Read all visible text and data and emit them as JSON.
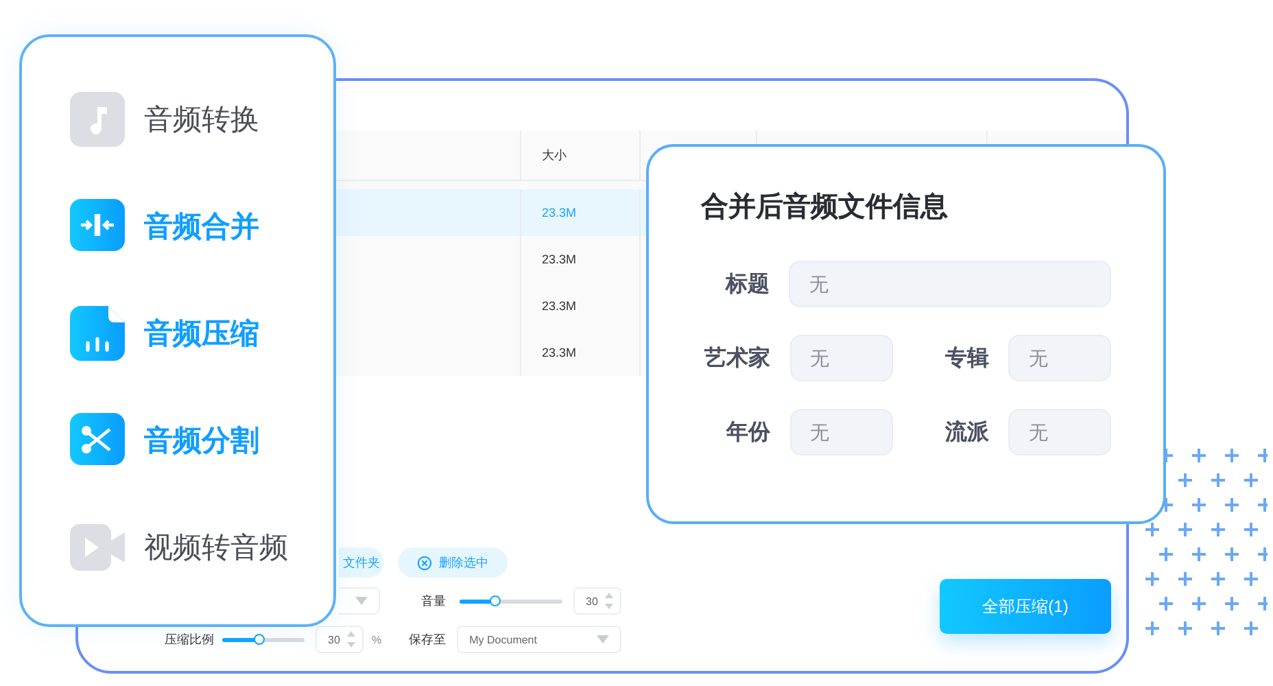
{
  "sidebar": {
    "items": [
      {
        "label": "音频转换",
        "active": false,
        "kind": "note"
      },
      {
        "label": "音频合并",
        "active": true,
        "kind": "merge"
      },
      {
        "label": "音频压缩",
        "active": true,
        "kind": "file"
      },
      {
        "label": "音频分割",
        "active": true,
        "kind": "scissors"
      },
      {
        "label": "视频转音频",
        "active": false,
        "kind": "video"
      }
    ]
  },
  "table": {
    "columns": [
      {
        "label": "大小"
      }
    ],
    "rows": [
      {
        "size": "23.3M",
        "selected": true
      },
      {
        "size": "23.3M",
        "selected": false
      },
      {
        "size": "23.3M",
        "selected": false
      },
      {
        "size": "23.3M",
        "selected": false
      }
    ]
  },
  "toolbar": {
    "buttons": [
      {
        "label": "文件夹",
        "kind": "plain"
      },
      {
        "label": "删除选中",
        "kind": "delete"
      }
    ]
  },
  "settings": {
    "volume": {
      "label": "音量",
      "level": 0.35,
      "value": "30"
    },
    "ratio": {
      "label": "压缩比例",
      "level": 0.45,
      "value": "30",
      "unit": "%"
    },
    "save_to": {
      "label": "保存至",
      "value": "My Document"
    }
  },
  "primary_button": {
    "label": "全部压缩(1)"
  },
  "info_panel": {
    "title": "合并后音频文件信息",
    "fields": [
      {
        "label": "标题",
        "placeholder": "无",
        "kind": "wide"
      },
      {
        "label": "艺术家",
        "placeholder": "无",
        "kind": "half"
      },
      {
        "label": "专辑",
        "placeholder": "无",
        "kind": "half"
      },
      {
        "label": "年份",
        "placeholder": "无",
        "kind": "half"
      },
      {
        "label": "流派",
        "placeholder": "无",
        "kind": "half"
      }
    ]
  }
}
